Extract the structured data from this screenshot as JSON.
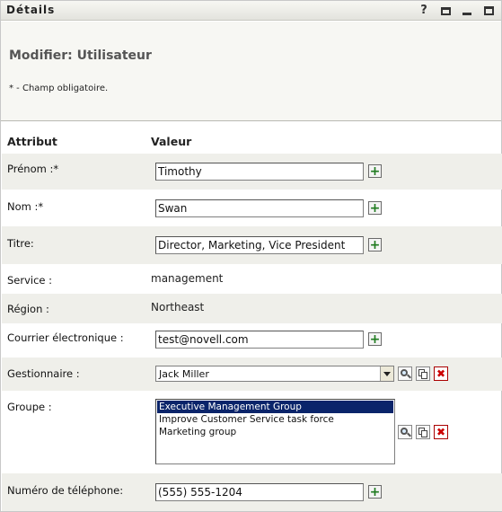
{
  "window": {
    "title": "Détails"
  },
  "toolbar": {
    "help_label": "?"
  },
  "page": {
    "title": "Modifier: Utilisateur",
    "required_note": "* - Champ obligatoire."
  },
  "table": {
    "col_attribute": "Attribut",
    "col_value": "Valeur"
  },
  "fields": {
    "prenom": {
      "label": "Prénom :*",
      "value": "Timothy"
    },
    "nom": {
      "label": "Nom :*",
      "value": "Swan"
    },
    "titre": {
      "label": "Titre:",
      "value": "Director, Marketing, Vice President"
    },
    "service": {
      "label": "Service :",
      "value": "management"
    },
    "region": {
      "label": "Région :",
      "value": "Northeast"
    },
    "courriel": {
      "label": "Courrier électronique :",
      "value": "test@novell.com"
    },
    "gestionnaire": {
      "label": "Gestionnaire :",
      "value": "Jack Miller"
    },
    "groupe": {
      "label": "Groupe :",
      "options": [
        "Executive Management Group",
        "Improve Customer Service task force",
        "Marketing group"
      ],
      "selected": "Executive Management Group"
    },
    "telephone": {
      "label": "Numéro de téléphone:",
      "value": "(555) 555-1204"
    }
  },
  "icons": {
    "add": "plus-icon",
    "lookup": "magnifier-icon",
    "history": "history-icon",
    "clear": "delete-icon"
  },
  "colors": {
    "header_bg": "#f7f7f3",
    "row_shade": "#efefea",
    "add_green": "#1e7a1e",
    "delete_red": "#cc0000",
    "selection_blue": "#0a246a"
  }
}
